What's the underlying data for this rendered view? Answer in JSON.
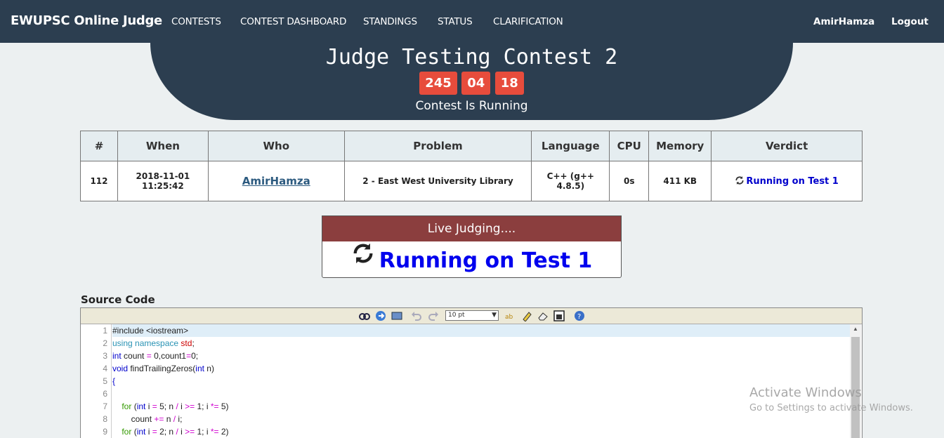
{
  "navbar": {
    "brand": "EWUPSC Online Judge",
    "items": [
      "CONTESTS",
      "CONTEST DASHBOARD",
      "STANDINGS",
      "STATUS",
      "CLARIFICATION"
    ],
    "user": "AmirHamza",
    "logout": "Logout"
  },
  "contest": {
    "title": "Judge Testing Contest 2",
    "timer": [
      "245",
      "04",
      "18"
    ],
    "status": "Contest Is Running"
  },
  "table": {
    "headers": [
      "#",
      "When",
      "Who",
      "Problem",
      "Language",
      "CPU",
      "Memory",
      "Verdict"
    ],
    "row": {
      "id": "112",
      "when_date": "2018-11-01",
      "when_time": "11:25:42",
      "who": "AmirHamza",
      "problem": "2 - East West University Library",
      "language": "C++ (g++ 4.8.5)",
      "cpu": "0s",
      "memory": "411 KB",
      "verdict": "Running on Test 1"
    }
  },
  "live": {
    "title": "Live Judging....",
    "verdict": "Running on Test 1"
  },
  "source": {
    "label": "Source Code",
    "font_size": "10 pt",
    "line_numbers": [
      "1",
      "2",
      "3",
      "4",
      "5",
      "6",
      "7",
      "8",
      "9"
    ]
  },
  "watermark": {
    "line1": "Activate Windows",
    "line2": "Go to Settings to activate Windows."
  },
  "colors": {
    "navbar": "#2c3e50",
    "timer": "#e74c3c",
    "live_header": "#8b3e3e",
    "verdict": "#0000ee"
  }
}
